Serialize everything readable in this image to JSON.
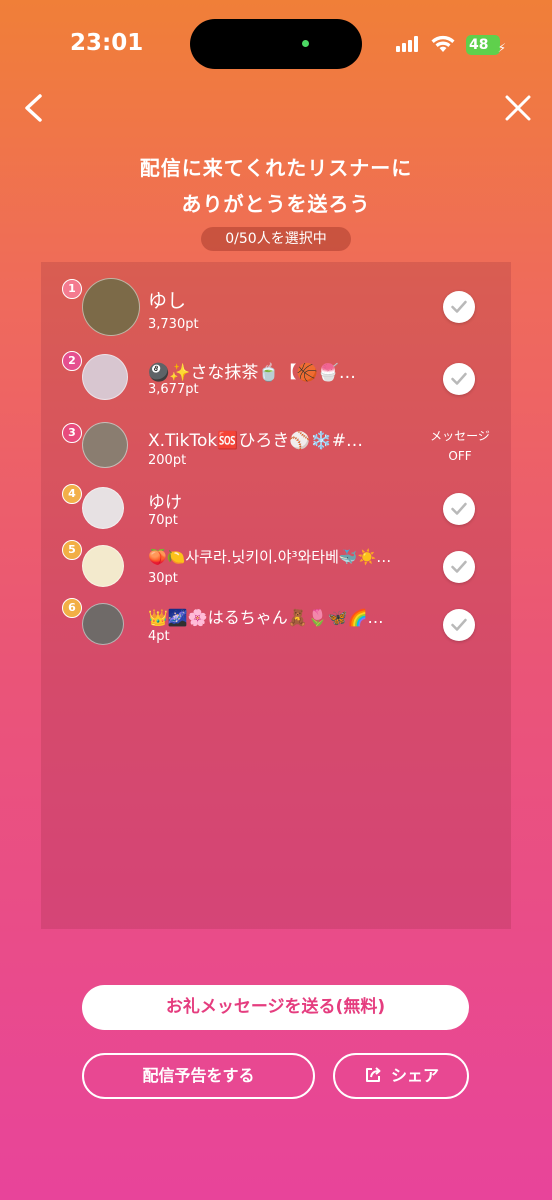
{
  "status_bar": {
    "time": "23:01",
    "battery": "48"
  },
  "header": {
    "title_line1": "配信に来てくれたリスナーに",
    "title_line2": "ありがとうを送ろう",
    "selection_counter": "0/50人を選択中"
  },
  "listeners": [
    {
      "rank": "1",
      "name": "ゆし",
      "points": "3,730pt",
      "rank_color": "#f47a8f",
      "avatar_color": "#7c6a48",
      "selectable": true
    },
    {
      "rank": "2",
      "name": "🎱✨さな抹茶🍵【🏀🍧…",
      "points": "3,677pt",
      "rank_color": "#e54f8f",
      "avatar_color": "#d8c6d0",
      "selectable": true
    },
    {
      "rank": "3",
      "name": "X.TikTok🆘ひろき⚾️❄️#…",
      "points": "200pt",
      "rank_color": "#e84b7d",
      "avatar_color": "#8a7d70",
      "selectable": false,
      "message_status": "メッセージ",
      "message_status_2": "OFF"
    },
    {
      "rank": "4",
      "name": "ゆけ",
      "points": "70pt",
      "rank_color": "#f2b04a",
      "avatar_color": "#e7e1e3",
      "selectable": true
    },
    {
      "rank": "5",
      "name": "🍑🍋사쿠라.닛키이.야³와타베🐳☀️…",
      "points": "30pt",
      "rank_color": "#f2ae45",
      "avatar_color": "#f3eacd",
      "selectable": true
    },
    {
      "rank": "6",
      "name": "👑🌌🌸はるちゃん🧸🌷🦋🌈…",
      "points": "4pt",
      "rank_color": "#f2ae45",
      "avatar_color": "#6f6a68",
      "selectable": true
    }
  ],
  "actions": {
    "send_thanks": "お礼メッセージを送る(無料)",
    "stream_preview": "配信予告をする",
    "share": "シェア"
  }
}
